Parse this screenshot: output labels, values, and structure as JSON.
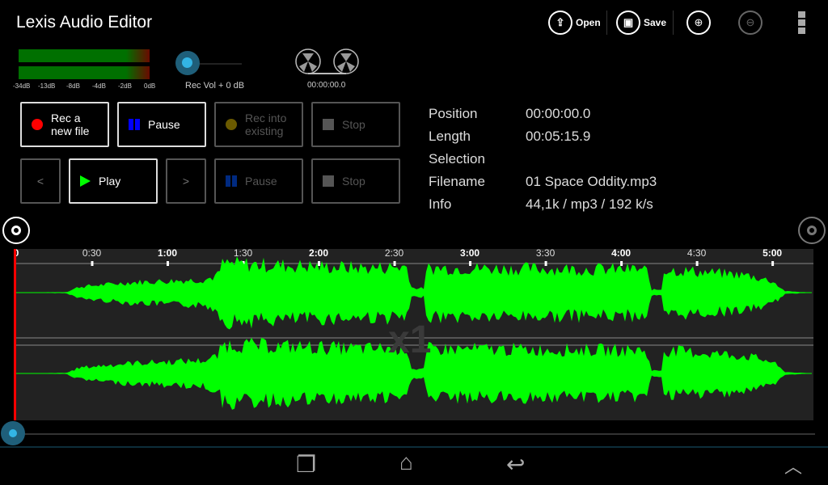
{
  "app": {
    "title": "Lexis Audio Editor"
  },
  "actionbar": {
    "open_label": "Open",
    "save_label": "Save",
    "icons": [
      "open-file-icon",
      "save-icon",
      "zoom-in-icon",
      "zoom-out-icon",
      "overflow-menu-icon"
    ]
  },
  "meter": {
    "labels": [
      "-34dB",
      "-13dB",
      "-8dB",
      "-4dB",
      "-2dB",
      "0dB"
    ]
  },
  "rec_volume": {
    "label": "Rec Vol + 0 dB",
    "level": 0
  },
  "tape": {
    "time": "00:00:00.0"
  },
  "record_buttons": {
    "rec_new": "Rec a\nnew file",
    "pause": "Pause",
    "rec_existing": "Rec into\nexisting",
    "stop": "Stop"
  },
  "play_buttons": {
    "prev": "<",
    "play": "Play",
    "next": ">",
    "pause": "Pause",
    "stop": "Stop"
  },
  "info": {
    "rows": [
      {
        "label": "Position",
        "value": "00:00:00.0"
      },
      {
        "label": "Length",
        "value": "00:05:15.9"
      },
      {
        "label": "Selection",
        "value": ""
      },
      {
        "label": "Filename",
        "value": "01 Space Oddity.mp3"
      },
      {
        "label": "Info",
        "value": "44,1k / mp3 / 192 k/s"
      }
    ]
  },
  "timeline": {
    "labels": [
      "0",
      "0:30",
      "1:00",
      "1:30",
      "2:00",
      "2:30",
      "3:00",
      "3:30",
      "4:00",
      "4:30",
      "5:00"
    ],
    "db_scale": [
      "0",
      "-3",
      "-6",
      "-9",
      "-11",
      "-21"
    ],
    "zoom_label": "x1"
  },
  "colors": {
    "waveform": "#00ff00",
    "cursor": "#ff0000",
    "accent": "#33b5e5"
  }
}
